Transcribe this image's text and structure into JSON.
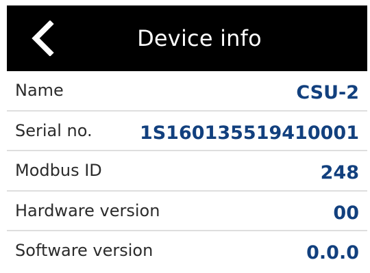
{
  "header": {
    "title": "Device info",
    "back_icon": "chevron-left-icon"
  },
  "info": {
    "rows": [
      {
        "label": "Name",
        "value": "CSU-2"
      },
      {
        "label": "Serial no.",
        "value": "1S160135519410001"
      },
      {
        "label": "Modbus ID",
        "value": "248"
      },
      {
        "label": "Hardware version",
        "value": "00"
      },
      {
        "label": "Software version",
        "value": "0.0.0"
      }
    ]
  },
  "colors": {
    "header_bg": "#000000",
    "header_text": "#ffffff",
    "value_text": "#12407e",
    "label_text": "#2b2b2b",
    "divider": "#dedede"
  }
}
